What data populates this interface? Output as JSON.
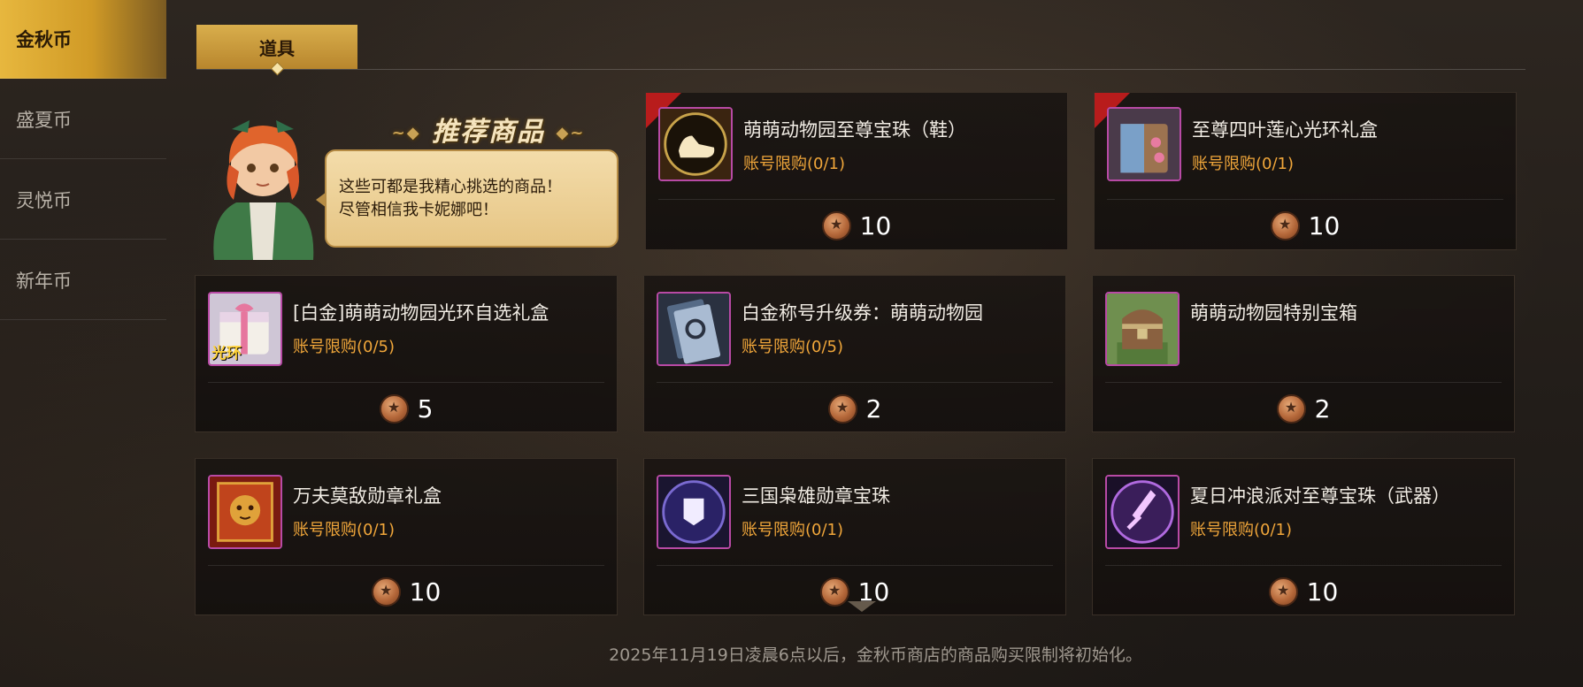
{
  "sidebar": {
    "items": [
      {
        "label": "金秋币"
      },
      {
        "label": "盛夏币"
      },
      {
        "label": "灵悦币"
      },
      {
        "label": "新年币"
      }
    ]
  },
  "tabs": [
    {
      "label": "道具"
    }
  ],
  "recommend": {
    "title": "推荐商品",
    "speech_line1": "这些可都是我精心挑选的商品！",
    "speech_line2": "尽管相信我卡妮娜吧！"
  },
  "items": [
    {
      "name": "萌萌动物园至尊宝珠（鞋）",
      "limit": "账号限购(0/1)",
      "price": "10"
    },
    {
      "name": "至尊四叶莲心光环礼盒",
      "limit": "账号限购(0/1)",
      "price": "10"
    },
    {
      "name": "[白金]萌萌动物园光环自选礼盒",
      "limit": "账号限购(0/5)",
      "price": "5",
      "icon_text": "光环"
    },
    {
      "name": "白金称号升级券：萌萌动物园",
      "limit": "账号限购(0/5)",
      "price": "2"
    },
    {
      "name": "萌萌动物园特别宝箱",
      "limit": "",
      "price": "2"
    },
    {
      "name": "万夫莫敌勋章礼盒",
      "limit": "账号限购(0/1)",
      "price": "10"
    },
    {
      "name": "三国枭雄勋章宝珠",
      "limit": "账号限购(0/1)",
      "price": "10"
    },
    {
      "name": "夏日冲浪派对至尊宝珠（武器）",
      "limit": "账号限购(0/1)",
      "price": "10"
    }
  ],
  "footer": "2025年11月19日凌晨6点以后，金秋币商店的商品购买限制将初始化。",
  "colors": {
    "accent_gold": "#d9ae4c",
    "limit_orange": "#f0a63a",
    "icon_border": "#b84aa5"
  }
}
